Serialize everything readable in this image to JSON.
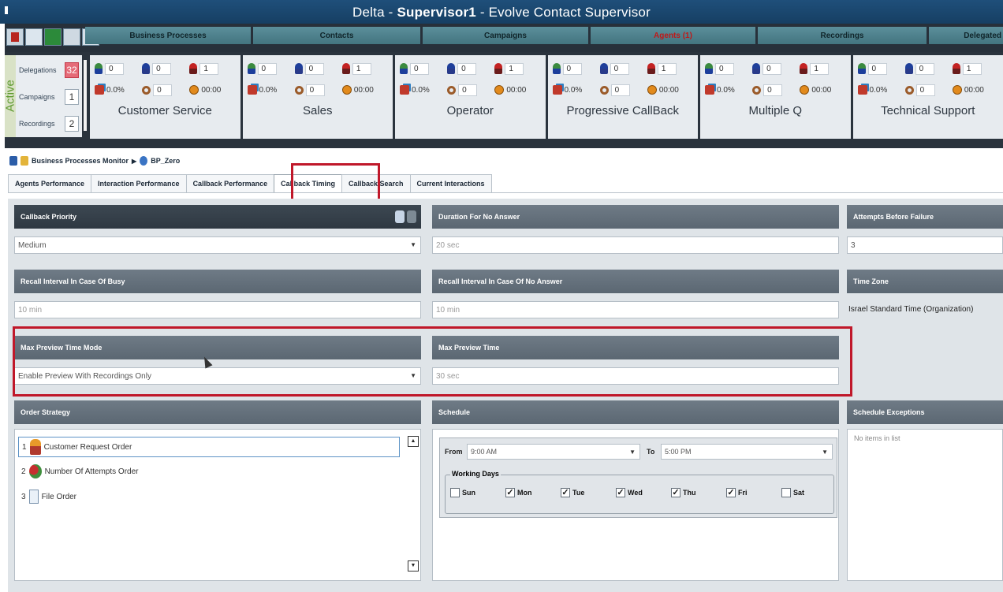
{
  "window": {
    "title_prefix": "Delta - ",
    "title_user": "Supervisor1",
    "title_suffix": " - Evolve Contact Supervisor"
  },
  "nav": {
    "icons": [
      "record-icon",
      "grid-icon",
      "refresh-icon",
      "monitor-icon",
      "signal-icon"
    ],
    "tabs": [
      {
        "label": "Business Processes",
        "active": false
      },
      {
        "label": "Contacts",
        "active": false
      },
      {
        "label": "Campaigns",
        "active": false
      },
      {
        "label": "Agents (1)",
        "active": true
      },
      {
        "label": "Recordings",
        "active": false
      },
      {
        "label": "Delegated",
        "active": false
      }
    ]
  },
  "dashboard": {
    "active_label": "Active",
    "counts": [
      {
        "label": "Delegations",
        "value": "32"
      },
      {
        "label": "Campaigns",
        "value": "1"
      },
      {
        "label": "Recordings",
        "value": "2"
      }
    ],
    "groups": [
      {
        "name": "Customer Service",
        "a": "0",
        "b": "0",
        "c": "1",
        "pct": "0.0%",
        "g": "0",
        "time": "00:00"
      },
      {
        "name": "Sales",
        "a": "0",
        "b": "0",
        "c": "1",
        "pct": "0.0%",
        "g": "0",
        "time": "00:00"
      },
      {
        "name": "Operator",
        "a": "0",
        "b": "0",
        "c": "1",
        "pct": "0.0%",
        "g": "0",
        "time": "00:00"
      },
      {
        "name": "Progressive CallBack",
        "a": "0",
        "b": "0",
        "c": "1",
        "pct": "0.0%",
        "g": "0",
        "time": "00:00"
      },
      {
        "name": "Multiple Q",
        "a": "0",
        "b": "0",
        "c": "1",
        "pct": "0.0%",
        "g": "0",
        "time": "00:00"
      },
      {
        "name": "Technical Support",
        "a": "0",
        "b": "0",
        "c": "1",
        "pct": "0.0%",
        "g": "0",
        "time": "00:00"
      }
    ]
  },
  "breadcrumb": {
    "root": "Business Processes Monitor",
    "current": "BP_Zero"
  },
  "subtabs": [
    {
      "label": "Agents Performance",
      "active": false
    },
    {
      "label": "Interaction Performance",
      "active": false
    },
    {
      "label": "Callback Performance",
      "active": false
    },
    {
      "label": "Callback Timing",
      "active": true
    },
    {
      "label": "Callback Search",
      "active": false
    },
    {
      "label": "Current Interactions",
      "active": false
    }
  ],
  "callback_priority": {
    "label": "Callback Priority",
    "value": "Medium"
  },
  "duration_no_answer": {
    "label": "Duration For No Answer",
    "value": "20 sec"
  },
  "attempts_before_failure": {
    "label": "Attempts Before Failure",
    "value": "3"
  },
  "recall_busy": {
    "label": "Recall Interval In Case Of Busy",
    "value": "10 min"
  },
  "recall_no_answer": {
    "label": "Recall Interval In Case Of No Answer",
    "value": "10 min"
  },
  "time_zone": {
    "label": "Time Zone",
    "value": "Israel Standard Time (Organization)"
  },
  "max_preview_mode": {
    "label": "Max Preview Time Mode",
    "value": "Enable Preview With Recordings Only"
  },
  "max_preview_time": {
    "label": "Max Preview Time",
    "value": "30 sec"
  },
  "order_strategy": {
    "label": "Order Strategy",
    "items": [
      {
        "num": "1",
        "label": "Customer Request Order"
      },
      {
        "num": "2",
        "label": "Number Of Attempts Order"
      },
      {
        "num": "3",
        "label": "File Order"
      }
    ]
  },
  "schedule": {
    "label": "Schedule",
    "from_label": "From",
    "from_value": "9:00 AM",
    "to_label": "To",
    "to_value": "5:00 PM",
    "working_days_label": "Working Days",
    "days": [
      {
        "label": "Sun",
        "checked": false
      },
      {
        "label": "Mon",
        "checked": true
      },
      {
        "label": "Tue",
        "checked": true
      },
      {
        "label": "Wed",
        "checked": true
      },
      {
        "label": "Thu",
        "checked": true
      },
      {
        "label": "Fri",
        "checked": true
      },
      {
        "label": "Sat",
        "checked": false
      }
    ]
  },
  "schedule_exceptions": {
    "label": "Schedule Exceptions",
    "empty_text": "No items in list"
  },
  "colors": {
    "highlight": "#c0182a",
    "active_tab_text": "#c01818",
    "header_bg": "#5b6772"
  }
}
